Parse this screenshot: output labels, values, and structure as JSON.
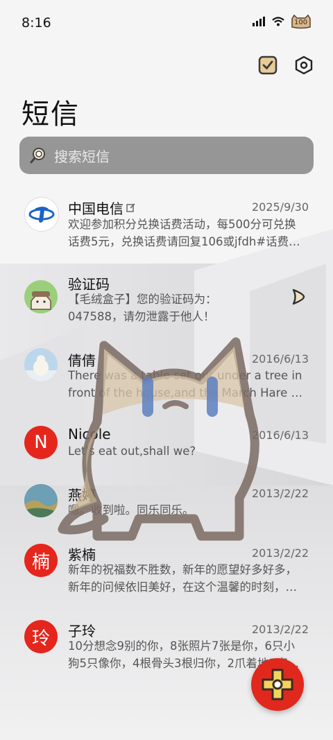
{
  "status_bar": {
    "time": "8:16",
    "battery": "100"
  },
  "header": {
    "title": "短信"
  },
  "search": {
    "placeholder": "搜索短信"
  },
  "conversations": [
    {
      "name": "中国电信",
      "date": "2025/9/30",
      "line1": "欢迎参加积分兑换话费活动，每500分可兑换",
      "line2": "话费5元，兑换话费请回复106或jfdh#话费…",
      "avatar": "china-telecom-logo"
    },
    {
      "name": "验证码",
      "date": "",
      "line1": "【毛绒盒子】您的验证码为：",
      "line2": "047588，请勿泄露于他人！",
      "avatar": "cat-avatar"
    },
    {
      "name": "倩倩",
      "date": "2016/6/13",
      "line1": "There was a table set out under a tree in",
      "line2": "front of the house,and the March Hare an…",
      "avatar": "polar-bear-photo"
    },
    {
      "name": "Nicole",
      "date": "2016/6/13",
      "line1": "Let's eat out,shall we?",
      "line2": "",
      "avatar_letter": "N"
    },
    {
      "name": "燕婷",
      "date": "2013/2/22",
      "line1": "嗯。收到啦。同乐同乐。",
      "line2": "",
      "avatar": "landscape-photo"
    },
    {
      "name": "紫楠",
      "date": "2013/2/22",
      "line1": "新年的祝福数不胜数，新年的愿望好多好多，",
      "line2": "新年的问候依旧美好，在这个温馨的时刻，…",
      "avatar_letter": "楠"
    },
    {
      "name": "子玲",
      "date": "2013/2/22",
      "line1": "10分想念9别的你，8张照片7张是你，6只小",
      "line2": "狗5只像你，4根骨头3根归你，2爪着地1室…",
      "avatar_letter": "玲"
    }
  ],
  "colors": {
    "accent_red": "#e1281d",
    "search_bg": "#8c8c8c"
  },
  "icons": [
    "signal-icon",
    "wifi-icon",
    "battery-icon",
    "select-check-icon",
    "settings-icon",
    "search-icon",
    "chevron-right-icon",
    "compose-icon"
  ]
}
